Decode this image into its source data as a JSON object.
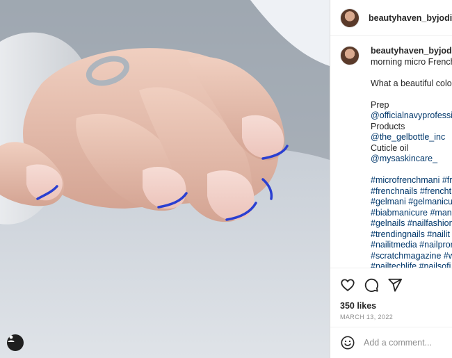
{
  "post": {
    "username": "beautyhaven_byjodie",
    "caption_lines": [
      "morning micro French",
      "",
      "What a beautiful colo",
      "",
      "Prep",
      "@officialnavyprofessi",
      "Products",
      "@the_gelbottle_inc",
      "Cuticle oil",
      "@mysaskincare_",
      "",
      "#microfrenchmani #fr",
      "#frenchnails #frencht",
      "#gelmani #gelmanicu",
      "#biabmanicure #mani",
      "#gelnails #nailfashion",
      "#trendingnails #nailit",
      "#nailitmedia #nailpror",
      "#scratchmagazine #w",
      "#nailtechlife #nailsofi"
    ],
    "likes": "350 likes",
    "date": "MARCH 13, 2022"
  },
  "icons": {
    "like": "heart-icon",
    "comment": "comment-icon",
    "share": "paper-plane-icon",
    "emoji": "emoji-icon",
    "tag": "user-tag-icon"
  },
  "comment_box": {
    "placeholder": "Add a comment..."
  },
  "colors": {
    "link": "#00376b",
    "nail_tip": "#2a3fd1",
    "nail_base": "#f1cfc8",
    "skin": "#e7bfae"
  }
}
